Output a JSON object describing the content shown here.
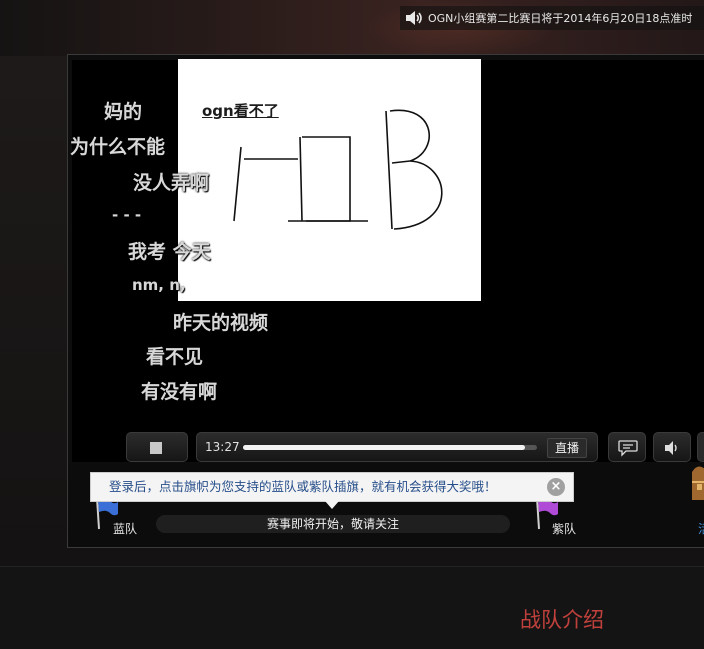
{
  "header": {
    "notice_text": "OGN小组赛第二比赛日将于2014年6月20日18点准时"
  },
  "video": {
    "danmaku": [
      "妈的",
      "ogn看不了",
      "为什么不能",
      "没人弄啊",
      "- - -",
      "我考  今天",
      "nm, n,",
      "昨天的视频",
      "看不见",
      "有没有啊"
    ],
    "drawing_text": "HB"
  },
  "controls": {
    "time": "13:27",
    "live_label": "直播",
    "progress": 0.96
  },
  "vote": {
    "tooltip": "登录后，点击旗帜为您支持的蓝队或紫队插旗，就有机会获得大奖哦！",
    "close_glyph": "×",
    "blue_team": "蓝队",
    "purple_team": "紫队",
    "status": "赛事即将开始，敬请关注",
    "side_link": "活"
  },
  "footer": {
    "team_intro": "战队介绍"
  },
  "colors": {
    "accent_red": "#c0413c",
    "tooltip_text": "#264e8a",
    "blue_flag": "#3a6fd8",
    "purple_flag": "#b04bd8"
  }
}
